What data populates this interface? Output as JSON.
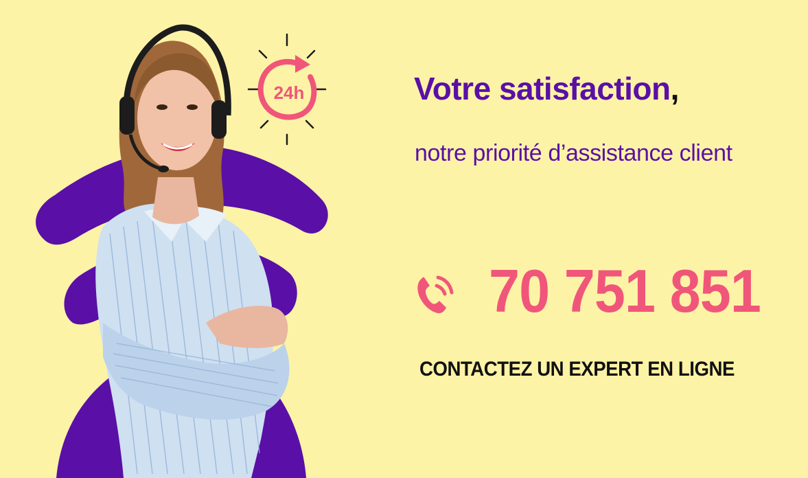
{
  "colors": {
    "background": "#fdf3a6",
    "purple": "#5a0fa7",
    "pink": "#f0567a",
    "text_dark": "#111111"
  },
  "badge": {
    "label": "24h",
    "icon": "clock-24h-icon"
  },
  "headline": {
    "title": "Votre satisfaction",
    "comma": ","
  },
  "subline": {
    "text": "notre priorité d’assistance client"
  },
  "phone": {
    "icon": "phone-ringing-icon",
    "number": "70 751 851"
  },
  "cta": {
    "label": "CONTACTEZ UN EXPERT EN LIGNE"
  },
  "illustration": {
    "subject": "support-agent-with-headset",
    "decor": "purple-signal-arcs"
  }
}
